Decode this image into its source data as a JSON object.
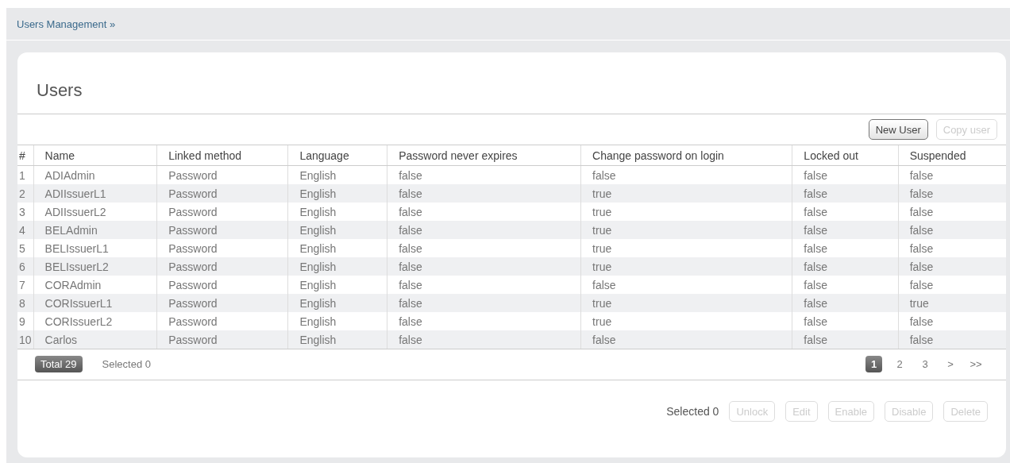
{
  "breadcrumb": {
    "label": "Users Management »"
  },
  "panel": {
    "title": "Users"
  },
  "toolbar": [
    {
      "label": "New User",
      "disabled": false
    },
    {
      "label": "Copy user",
      "disabled": true
    }
  ],
  "table": {
    "columns": [
      "#",
      "Name",
      "Linked method",
      "Language",
      "Password never expires",
      "Change password on login",
      "Locked out",
      "Suspended"
    ],
    "rows": [
      [
        "1",
        "ADIAdmin",
        "Password",
        "English",
        "false",
        "false",
        "false",
        "false"
      ],
      [
        "2",
        "ADIIssuerL1",
        "Password",
        "English",
        "false",
        "true",
        "false",
        "false"
      ],
      [
        "3",
        "ADIIssuerL2",
        "Password",
        "English",
        "false",
        "true",
        "false",
        "false"
      ],
      [
        "4",
        "BELAdmin",
        "Password",
        "English",
        "false",
        "true",
        "false",
        "false"
      ],
      [
        "5",
        "BELIssuerL1",
        "Password",
        "English",
        "false",
        "true",
        "false",
        "false"
      ],
      [
        "6",
        "BELIssuerL2",
        "Password",
        "English",
        "false",
        "true",
        "false",
        "false"
      ],
      [
        "7",
        "CORAdmin",
        "Password",
        "English",
        "false",
        "false",
        "false",
        "false"
      ],
      [
        "8",
        "CORIssuerL1",
        "Password",
        "English",
        "false",
        "true",
        "false",
        "true"
      ],
      [
        "9",
        "CORIssuerL2",
        "Password",
        "English",
        "false",
        "true",
        "false",
        "false"
      ],
      [
        "10",
        "Carlos",
        "Password",
        "English",
        "false",
        "false",
        "false",
        "false"
      ]
    ]
  },
  "summary": {
    "total": "Total 29",
    "selected": "Selected 0"
  },
  "pagination": [
    {
      "label": "1",
      "selected": true
    },
    {
      "label": "2",
      "selected": false
    },
    {
      "label": "3",
      "selected": false
    },
    {
      "label": ">",
      "selected": false
    },
    {
      "label": ">>",
      "selected": false
    }
  ],
  "actions": {
    "selected": "Selected 0",
    "buttons": [
      {
        "label": "Unlock",
        "disabled": true
      },
      {
        "label": "Edit",
        "disabled": true
      },
      {
        "label": "Enable",
        "disabled": true
      },
      {
        "label": "Disable",
        "disabled": true
      },
      {
        "label": "Delete",
        "disabled": true
      }
    ]
  }
}
